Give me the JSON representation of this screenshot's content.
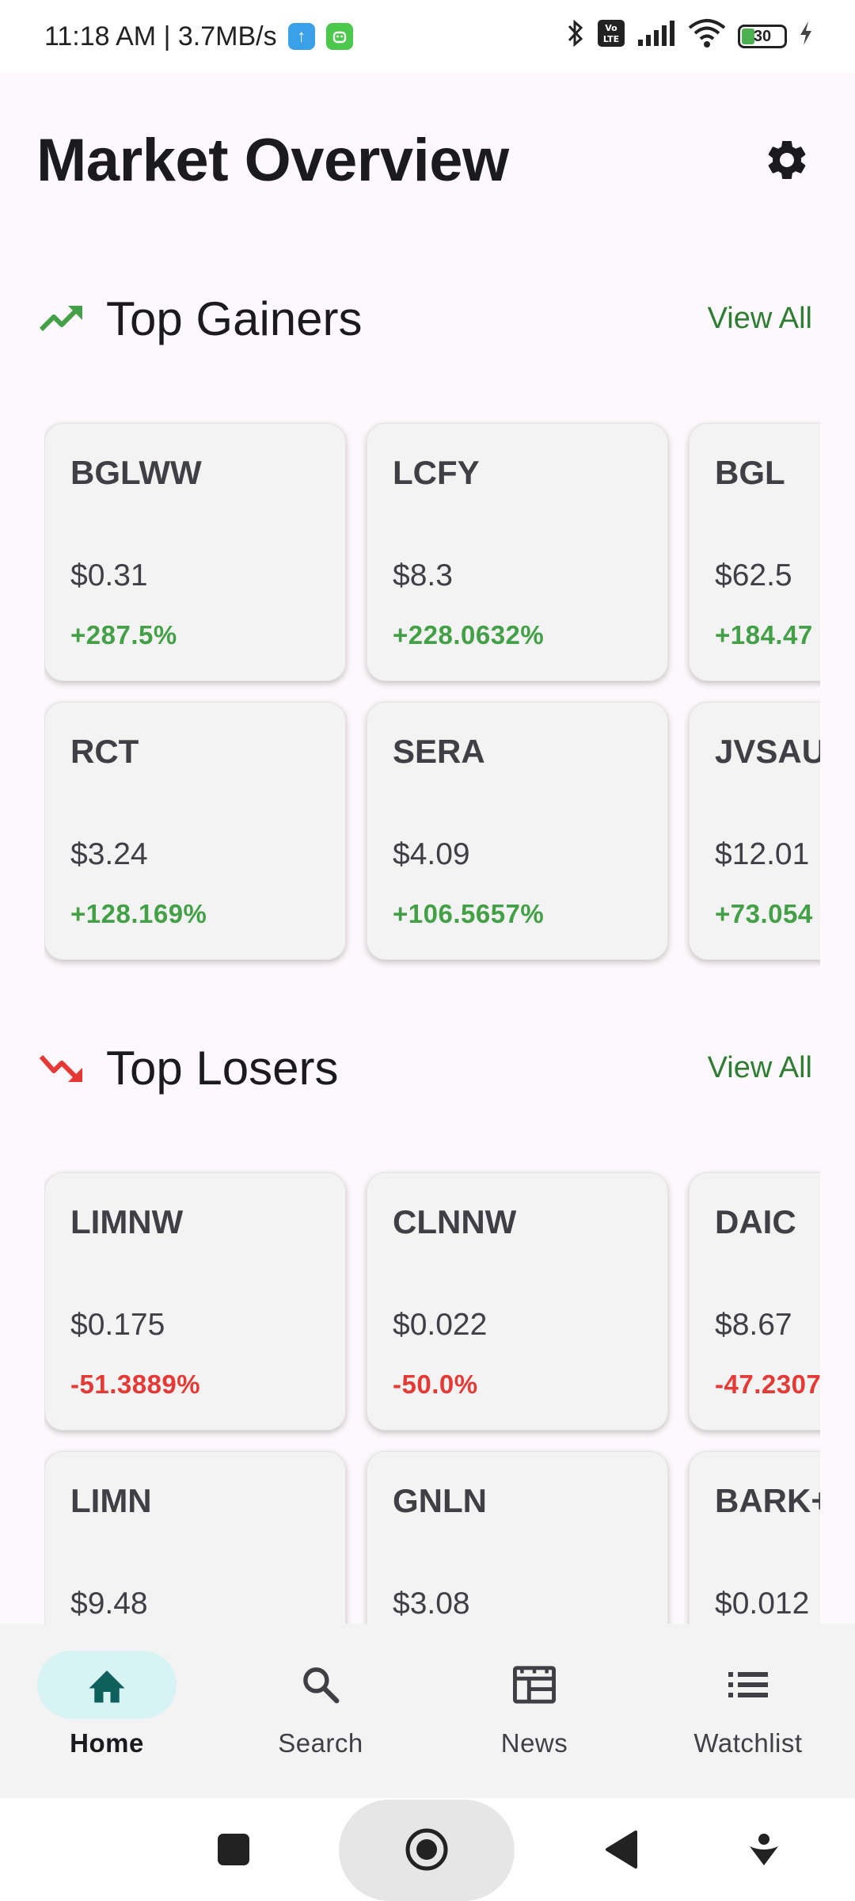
{
  "status_bar": {
    "time_speed": "11:18 AM | 3.7MB/s",
    "battery_level": "30",
    "colors": {
      "upload_badge": "#3aa0e8",
      "android_badge": "#4cc84c"
    }
  },
  "header": {
    "title": "Market Overview",
    "settings_icon": "gear-icon"
  },
  "gainers": {
    "title": "Top Gainers",
    "view_all": "View All",
    "icon": "trending-up-icon",
    "cards": [
      {
        "ticker": "BGLWW",
        "price": "$0.31",
        "change": "+287.5%"
      },
      {
        "ticker": "LCFY",
        "price": "$8.3",
        "change": "+228.0632%"
      },
      {
        "ticker": "BGL",
        "price": "$62.5",
        "change": "+184.47"
      },
      {
        "ticker": "RCT",
        "price": "$3.24",
        "change": "+128.169%"
      },
      {
        "ticker": "SERA",
        "price": "$4.09",
        "change": "+106.5657%"
      },
      {
        "ticker": "JVSAU",
        "price": "$12.01",
        "change": "+73.054"
      }
    ]
  },
  "losers": {
    "title": "Top Losers",
    "view_all": "View All",
    "icon": "trending-down-icon",
    "cards": [
      {
        "ticker": "LIMNW",
        "price": "$0.175",
        "change": "-51.3889%"
      },
      {
        "ticker": "CLNNW",
        "price": "$0.022",
        "change": "-50.0%"
      },
      {
        "ticker": "DAIC",
        "price": "$8.67",
        "change": "-47.2307"
      },
      {
        "ticker": "LIMN",
        "price": "$9.48",
        "change": ""
      },
      {
        "ticker": "GNLN",
        "price": "$3.08",
        "change": ""
      },
      {
        "ticker": "BARK+",
        "price": "$0.012",
        "change": ""
      }
    ]
  },
  "bottom_nav": {
    "items": [
      {
        "label": "Home",
        "icon": "home-icon",
        "active": true
      },
      {
        "label": "Search",
        "icon": "search-icon",
        "active": false
      },
      {
        "label": "News",
        "icon": "news-icon",
        "active": false
      },
      {
        "label": "Watchlist",
        "icon": "list-icon",
        "active": false
      }
    ]
  },
  "colors": {
    "gain": "#43a047",
    "loss": "#e53935",
    "accent_link": "#2e7d32",
    "active_nav_bg": "#d8f3f4",
    "home_icon": "#0f5f5c"
  }
}
